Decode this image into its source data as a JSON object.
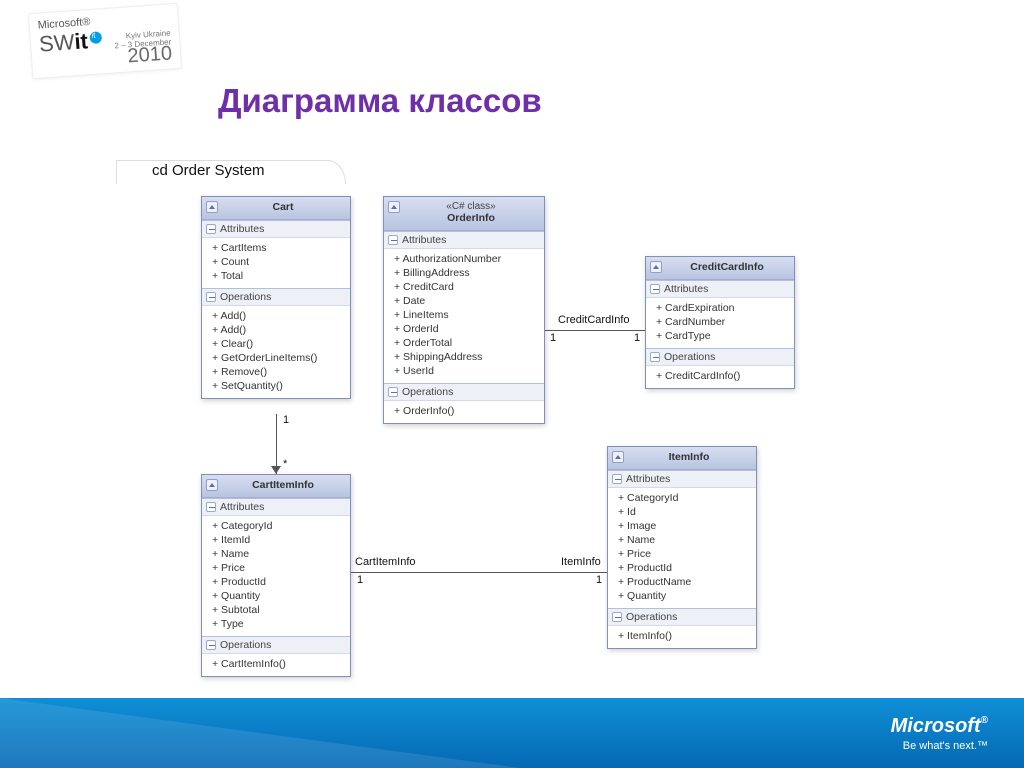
{
  "slide": {
    "title": "Диаграмма классов",
    "diagram_label": "cd Order System"
  },
  "badge": {
    "microsoft": "Microsoft®",
    "prefix": "SW",
    "bold": "it",
    "kyiv_line1": "Kyiv Ukraine",
    "kyiv_line2": "2 – 3 December",
    "year": "2010"
  },
  "classes": {
    "cart": {
      "name": "Cart",
      "attrs_label": "Attributes",
      "ops_label": "Operations",
      "attrs": [
        "+ CartItems",
        "+ Count",
        "+ Total"
      ],
      "ops": [
        "+ Add()",
        "+ Add()",
        "+ Clear()",
        "+ GetOrderLineItems()",
        "+ Remove()",
        "+ SetQuantity()"
      ]
    },
    "orderinfo": {
      "stereo": "«C# class»",
      "name": "OrderInfo",
      "attrs_label": "Attributes",
      "ops_label": "Operations",
      "attrs": [
        "+ AuthorizationNumber",
        "+ BillingAddress",
        "+ CreditCard",
        "+ Date",
        "+ LineItems",
        "+ OrderId",
        "+ OrderTotal",
        "+ ShippingAddress",
        "+ UserId"
      ],
      "ops": [
        "+ OrderInfo()"
      ]
    },
    "creditcard": {
      "name": "CreditCardInfo",
      "attrs_label": "Attributes",
      "ops_label": "Operations",
      "attrs": [
        "+ CardExpiration",
        "+ CardNumber",
        "+ CardType"
      ],
      "ops": [
        "+ CreditCardInfo()"
      ]
    },
    "cartitem": {
      "name": "CartItemInfo",
      "attrs_label": "Attributes",
      "ops_label": "Operations",
      "attrs": [
        "+ CategoryId",
        "+ ItemId",
        "+ Name",
        "+ Price",
        "+ ProductId",
        "+ Quantity",
        "+ Subtotal",
        "+ Type"
      ],
      "ops": [
        "+ CartItemInfo()"
      ]
    },
    "iteminfo": {
      "name": "ItemInfo",
      "attrs_label": "Attributes",
      "ops_label": "Operations",
      "attrs": [
        "+ CategoryId",
        "+ Id",
        "+ Image",
        "+ Name",
        "+ Price",
        "+ ProductId",
        "+ ProductName",
        "+ Quantity"
      ],
      "ops": [
        "+ ItemInfo()"
      ]
    }
  },
  "relations": {
    "cart_to_cartitem": {
      "top_card": "1",
      "bottom_card": "*"
    },
    "order_to_credit": {
      "role": "CreditCardInfo",
      "left_card": "1",
      "right_card": "1"
    },
    "cartitem_to_item": {
      "left_role": "CartItemInfo",
      "right_role": "ItemInfo",
      "left_card": "1",
      "right_card": "1"
    }
  },
  "footer": {
    "logo": "Microsoft",
    "reg": "®",
    "tag": "Be what's next.™"
  }
}
